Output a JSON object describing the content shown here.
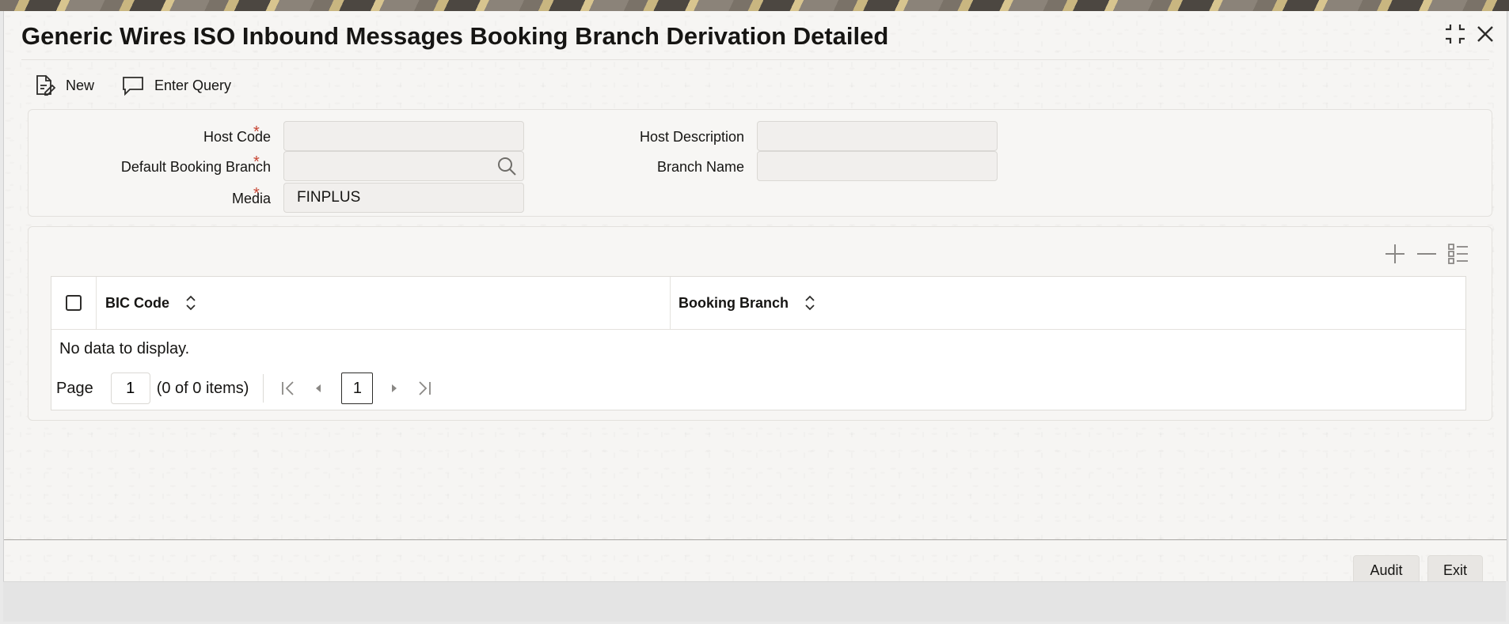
{
  "window": {
    "title": "Generic Wires ISO Inbound Messages Booking Branch Derivation Detailed"
  },
  "toolbar": {
    "new_label": "New",
    "enter_query_label": "Enter Query"
  },
  "form": {
    "host_code_label": "Host Code",
    "host_code_value": "",
    "default_booking_branch_label": "Default Booking Branch",
    "default_booking_branch_value": "",
    "media_label": "Media",
    "media_value": "FINPLUS",
    "host_description_label": "Host Description",
    "host_description_value": "",
    "branch_name_label": "Branch Name",
    "branch_name_value": "",
    "required_mark": "*"
  },
  "grid": {
    "columns": [
      "BIC Code",
      "Booking Branch"
    ],
    "empty_message": "No data to display.",
    "pager": {
      "page_label": "Page",
      "page_value": "1",
      "items_summary": "(0 of 0 items)",
      "current_page": "1"
    }
  },
  "footer": {
    "audit_label": "Audit",
    "exit_label": "Exit"
  },
  "icons": {
    "collapse": "collapse-icon",
    "close": "close-icon",
    "new": "new-document-icon",
    "enter_query": "speech-bubble-icon",
    "search": "search-icon",
    "add_row": "plus-icon",
    "delete_row": "minus-icon",
    "single_view": "list-view-icon",
    "sort": "sort-icon",
    "first_page": "first-page-icon",
    "prev_page": "previous-page-icon",
    "next_page": "next-page-icon",
    "last_page": "last-page-icon"
  },
  "colors": {
    "required": "#c74634",
    "text": "#161513",
    "panel": "#f7f6f4"
  }
}
